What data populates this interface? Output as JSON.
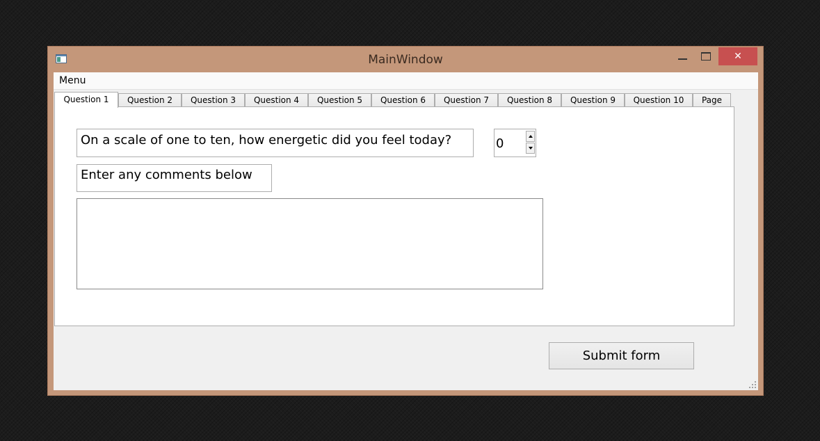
{
  "window": {
    "title": "MainWindow",
    "close_glyph": "✕",
    "colors": {
      "frame": "#c4977a",
      "close": "#c75050"
    }
  },
  "menu": {
    "label": "Menu"
  },
  "tabs": [
    "Question 1",
    "Question 2",
    "Question 3",
    "Question 4",
    "Question 5",
    "Question 6",
    "Question 7",
    "Question 8",
    "Question 9",
    "Question 10",
    "Page"
  ],
  "active_tab": "Question 1",
  "question": {
    "text": "On a scale of one to ten, how energetic did you feel today?",
    "value": "0"
  },
  "comments": {
    "label": "Enter any comments below",
    "value": ""
  },
  "submit": {
    "label": "Submit form"
  }
}
